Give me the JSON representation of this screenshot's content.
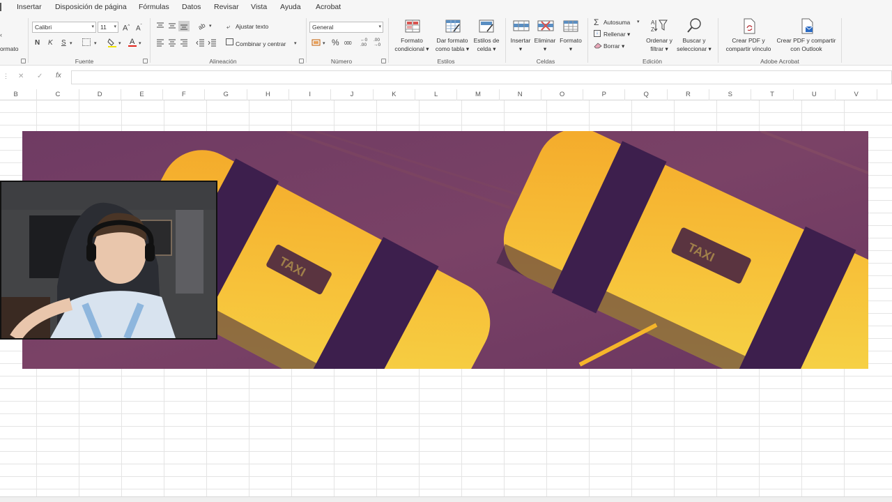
{
  "menu": {
    "items": [
      "Insertar",
      "Disposición de página",
      "Fórmulas",
      "Datos",
      "Revisar",
      "Vista",
      "Ayuda",
      "Acrobat"
    ]
  },
  "ribbon": {
    "clipboard": {
      "format_label": "ormato"
    },
    "font": {
      "name": "Calibri",
      "size": "11",
      "bold": "N",
      "italic": "K",
      "underline": "S",
      "label": "Fuente"
    },
    "alignment": {
      "wrap_text": "Ajustar texto",
      "merge_center": "Combinar y centrar",
      "label": "Alineación"
    },
    "number": {
      "format": "General",
      "label": "Número"
    },
    "styles": {
      "conditional_format": [
        "Formato",
        "condicional"
      ],
      "format_as_table": [
        "Dar formato",
        "como tabla"
      ],
      "cell_styles": [
        "Estilos de",
        "celda"
      ],
      "label": "Estilos"
    },
    "cells": {
      "insert": "Insertar",
      "delete": "Eliminar",
      "format": "Formato",
      "label": "Celdas"
    },
    "editing": {
      "autosum": "Autosuma",
      "fill": "Rellenar",
      "clear": "Borrar",
      "sort_filter": [
        "Ordenar y",
        "filtrar"
      ],
      "find_select": [
        "Buscar y",
        "seleccionar"
      ],
      "label": "Edición"
    },
    "acrobat": {
      "create_pdf_link": [
        "Crear PDF y",
        "compartir vínculo"
      ],
      "create_pdf_outlook": [
        "Crear PDF y compartir",
        "con Outlook"
      ],
      "label": "Adobe Acrobat"
    }
  },
  "formula_bar": {
    "fx": "fx",
    "value": ""
  },
  "columns": [
    "B",
    "C",
    "D",
    "E",
    "F",
    "G",
    "H",
    "I",
    "J",
    "K",
    "L",
    "M",
    "N",
    "O",
    "P",
    "Q",
    "R",
    "S",
    "T",
    "U",
    "V"
  ],
  "banner": {
    "taxi_text": "TAXI"
  },
  "colors": {
    "banner_bg": "#6d3a61",
    "taxi_yellow": "#f5b52a",
    "taxi_stripe": "#3d1f4d",
    "ribbon_bg": "#f6f6f6",
    "excel_red": "#c0392b",
    "accent_blue": "#5a8ec2"
  }
}
